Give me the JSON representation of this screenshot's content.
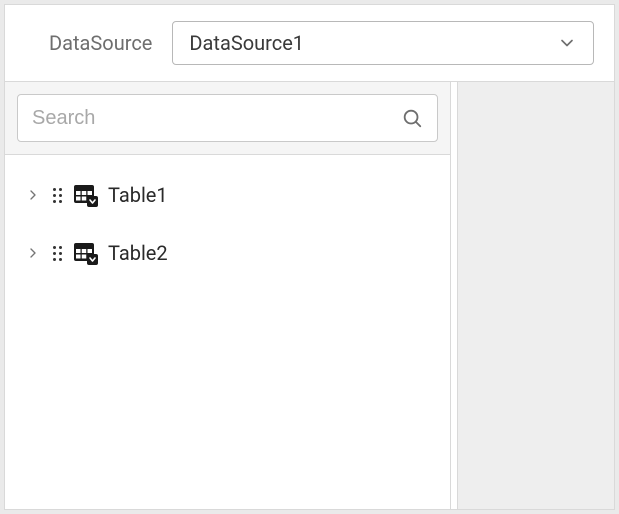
{
  "header": {
    "label": "DataSource",
    "selected": "DataSource1"
  },
  "search": {
    "placeholder": "Search",
    "value": ""
  },
  "tree": {
    "items": [
      {
        "label": "Table1"
      },
      {
        "label": "Table2"
      }
    ]
  }
}
